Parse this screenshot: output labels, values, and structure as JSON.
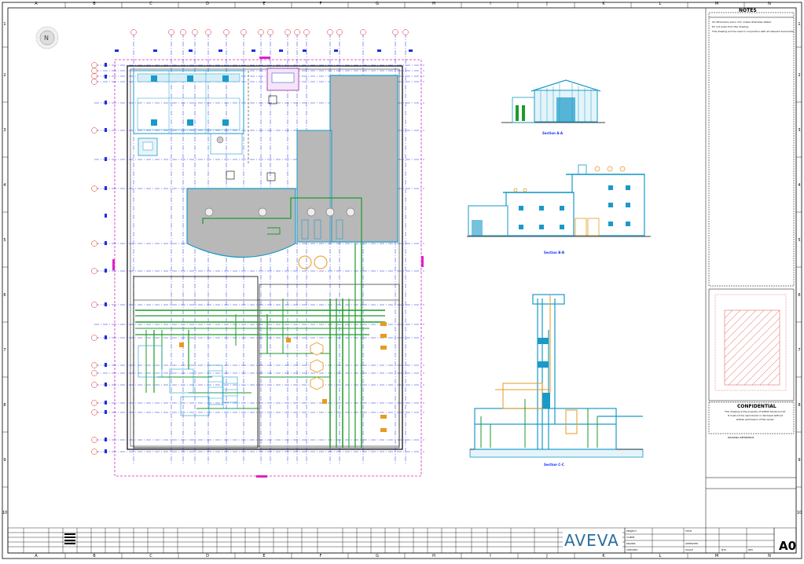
{
  "sheet": {
    "size": "A0",
    "brand": "AVEVA",
    "col_zones": [
      "A",
      "B",
      "C",
      "D",
      "E",
      "F",
      "G",
      "H",
      "I",
      "J",
      "K",
      "L",
      "M",
      "N"
    ],
    "row_zones": [
      "1",
      "2",
      "3",
      "4",
      "5",
      "6",
      "7",
      "8",
      "9",
      "10"
    ]
  },
  "notes": {
    "title": "NOTES",
    "lines": [
      "All dimensions are in mm unless otherwise stated.",
      "Do not scale from this drawing.",
      "This drawing is to be read in conjunction with all relevant documents."
    ]
  },
  "views": {
    "section_aa": "Section A-A",
    "section_bb": "Section B-B",
    "section_cc": "Section C-C"
  },
  "confidential": {
    "title": "CONFIDENTIAL",
    "lines": [
      "This drawing is the property of AVEVA Solutions Ltd.",
      "It must not be reproduced or disclosed without",
      "written permission of the owner."
    ],
    "ref": "DRAWING REFERENCE"
  },
  "title_block": {
    "project_label": "PROJECT",
    "client_label": "CLIENT",
    "title_label": "TITLE",
    "drawn_label": "DRAWN",
    "checked_label": "CHECKED",
    "approved_label": "APPROVED",
    "scale_label": "SCALE",
    "scale_value": "NTS",
    "rev_label": "REV"
  },
  "colors": {
    "border": "#000000",
    "grid_blue": "#1d2fe0",
    "magenta": "#e020c8",
    "cyan": "#1a9ac8",
    "green": "#1d9a2a",
    "orange": "#e89a20",
    "red": "#e02020",
    "grey_fill": "#b8b8b8"
  }
}
